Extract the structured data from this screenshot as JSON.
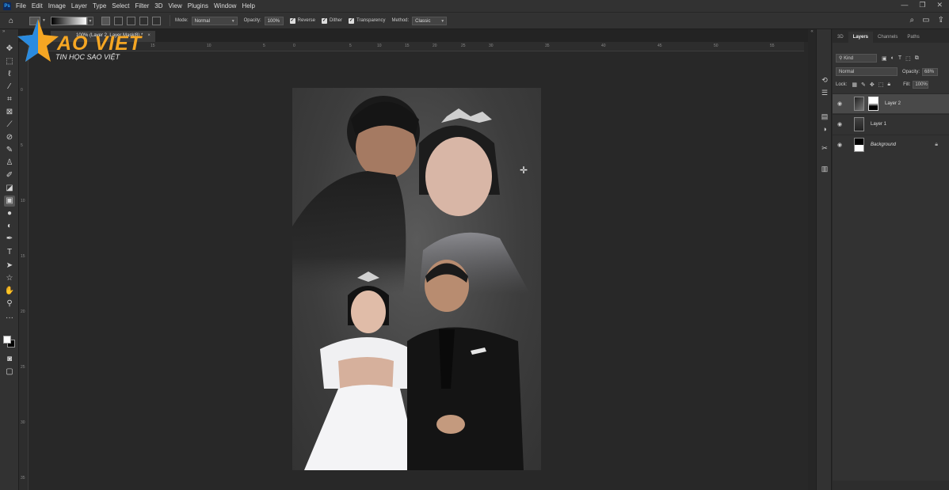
{
  "menu": {
    "app_badge": "Ps",
    "items": [
      "File",
      "Edit",
      "Image",
      "Layer",
      "Type",
      "Select",
      "Filter",
      "3D",
      "View",
      "Plugins",
      "Window",
      "Help"
    ],
    "window_controls": [
      "—",
      "❐",
      "✕"
    ]
  },
  "options": {
    "mode_label": "Mode:",
    "mode_value": "Normal",
    "opacity_label": "Opacity:",
    "opacity_value": "100%",
    "reverse_label": "Reverse",
    "dither_label": "Dither",
    "transparency_label": "Transparency",
    "method_label": "Method:",
    "method_value": "Classic"
  },
  "document": {
    "tab_title": "100% (Layer 2, Layer Mask/8) *",
    "close": "×"
  },
  "ruler": {
    "top_ticks": [
      "15",
      "10",
      "5",
      "0",
      "5",
      "10",
      "15",
      "20",
      "25",
      "30",
      "35",
      "40",
      "45",
      "50",
      "55"
    ],
    "left_ticks": [
      "0",
      "5",
      "10",
      "15",
      "20",
      "25",
      "30",
      "35"
    ]
  },
  "logo": {
    "brand": "AO VIET",
    "subtitle": "TIN HỌC SAO VIỆT"
  },
  "layers_panel": {
    "tabs": [
      "3D",
      "Layers",
      "Channels",
      "Paths"
    ],
    "filter_kind": "Kind",
    "blend_mode": "Normal",
    "opacity_label": "Opacity:",
    "opacity_value": "68%",
    "lock_label": "Lock:",
    "fill_label": "Fill:",
    "fill_value": "100%",
    "layers": [
      {
        "name": "Layer 2",
        "selected": true
      },
      {
        "name": "Layer 1",
        "selected": false
      },
      {
        "name": "Background",
        "selected": false
      }
    ]
  }
}
